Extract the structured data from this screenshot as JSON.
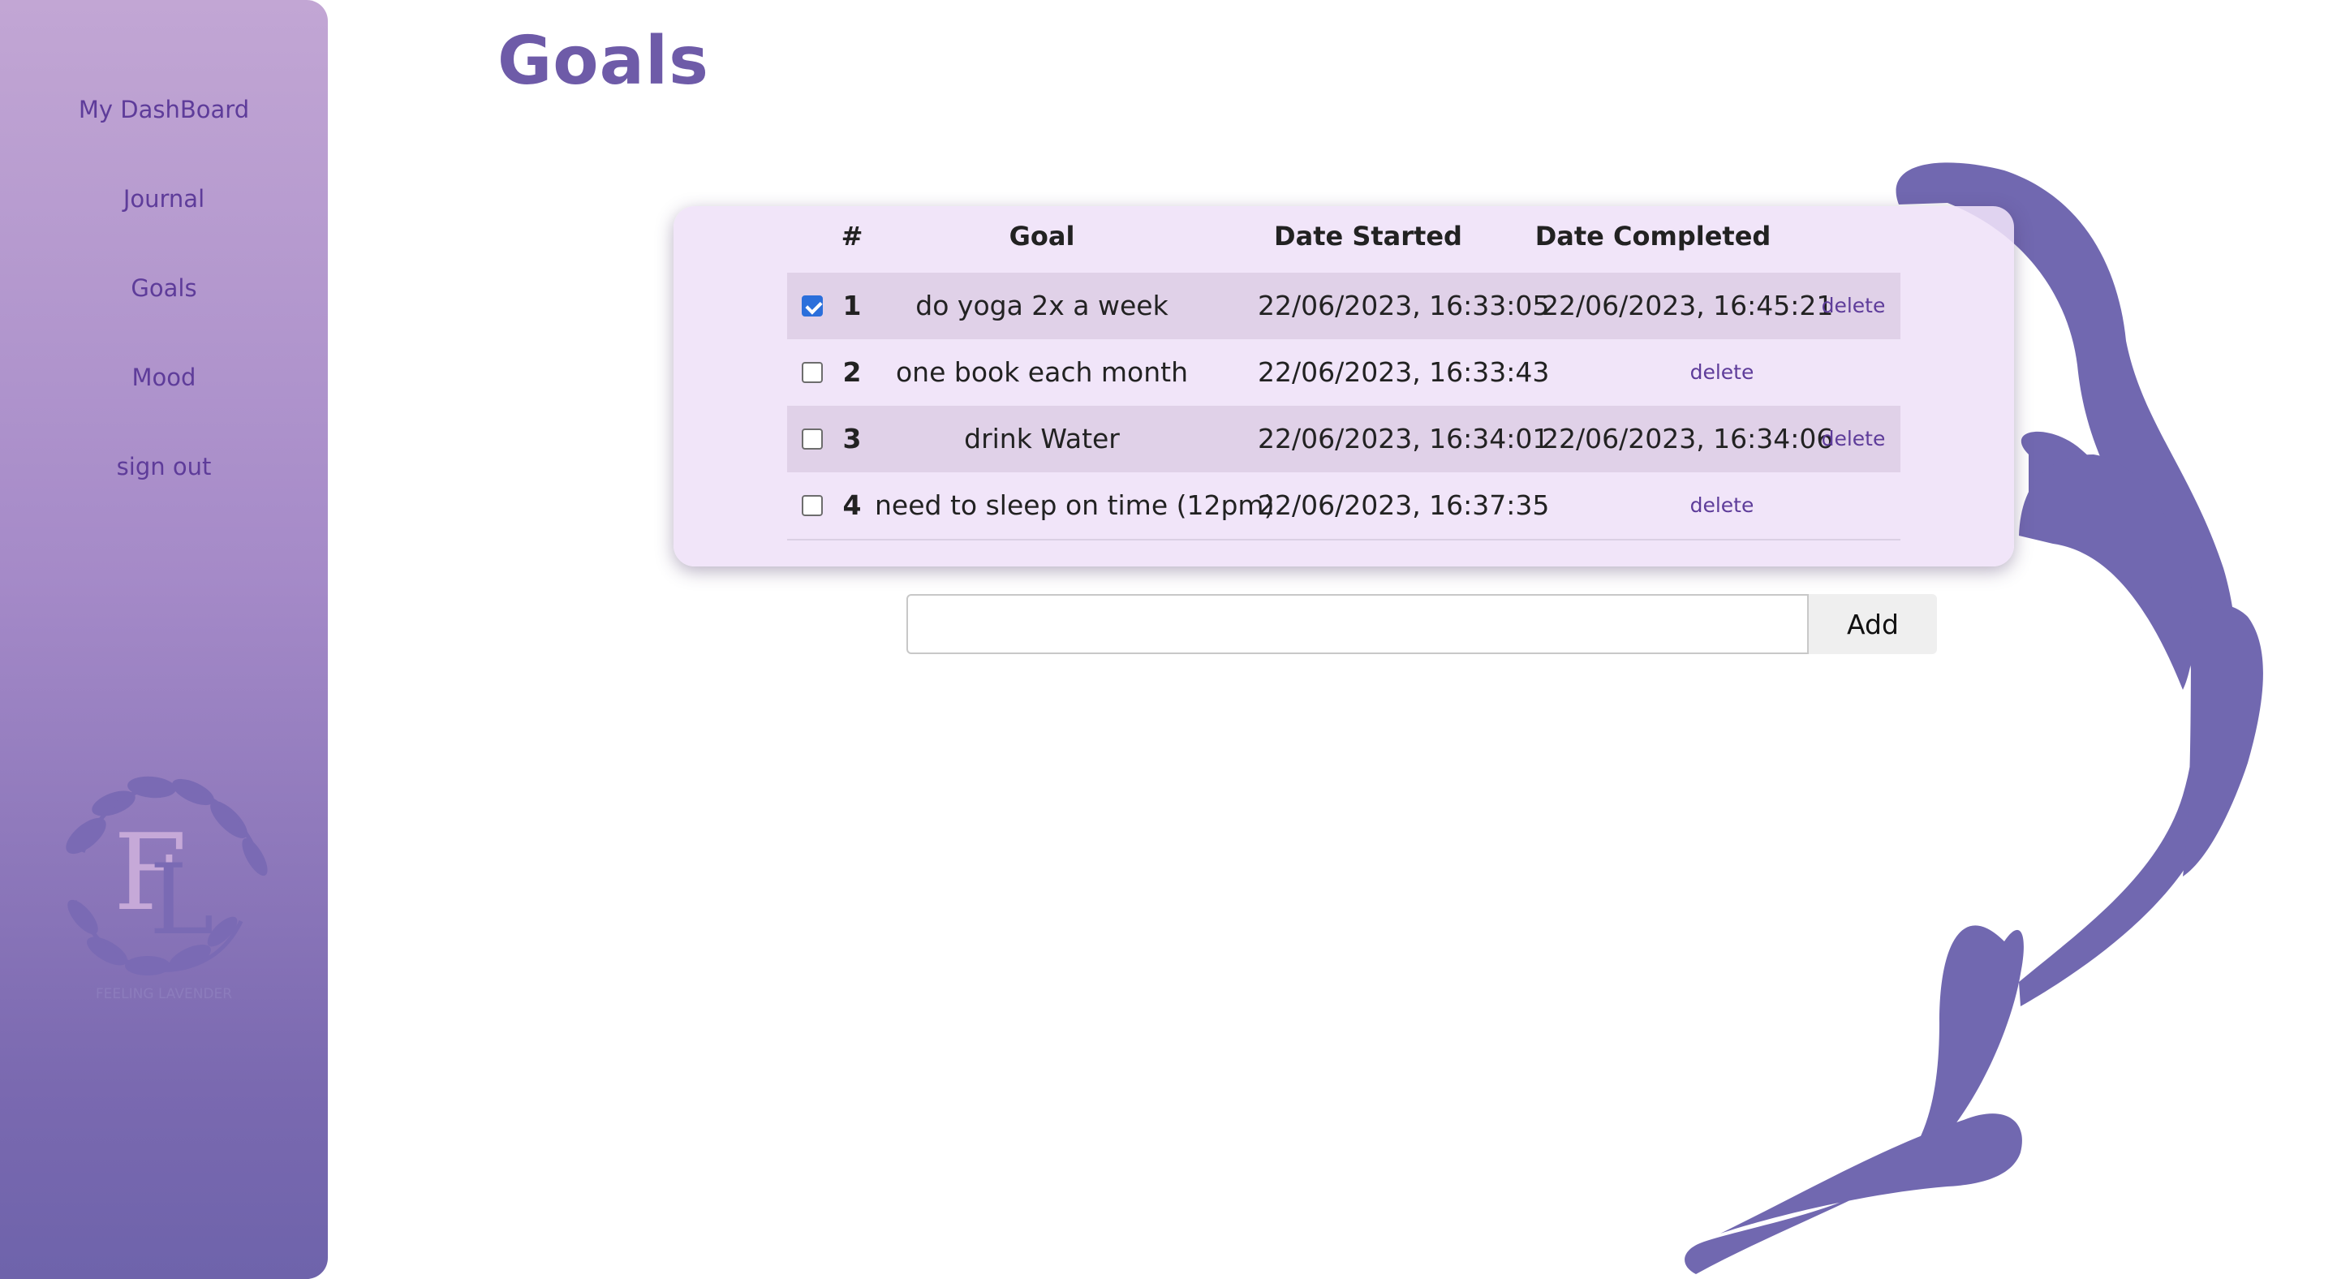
{
  "page": {
    "title": "Goals"
  },
  "sidebar": {
    "items": [
      {
        "label": "My DashBoard"
      },
      {
        "label": "Journal"
      },
      {
        "label": "Goals"
      },
      {
        "label": "Mood"
      },
      {
        "label": "sign out"
      }
    ],
    "logo": {
      "letters": "FL",
      "caption": "FEELING LAVENDER"
    }
  },
  "goals_table": {
    "headers": {
      "number": "#",
      "goal": "Goal",
      "date_started": "Date Started",
      "date_completed": "Date Completed"
    },
    "rows": [
      {
        "checked": true,
        "number": "1",
        "goal": "do yoga 2x a week",
        "date_started": "22/06/2023, 16:33:05",
        "date_completed": "22/06/2023, 16:45:21",
        "delete_label": "delete"
      },
      {
        "checked": false,
        "number": "2",
        "goal": "one book each month",
        "date_started": "22/06/2023, 16:33:43",
        "date_completed": "",
        "delete_label": "delete"
      },
      {
        "checked": false,
        "number": "3",
        "goal": "drink Water",
        "date_started": "22/06/2023, 16:34:01",
        "date_completed": "22/06/2023, 16:34:06",
        "delete_label": "delete"
      },
      {
        "checked": false,
        "number": "4",
        "goal": "need to sleep on time (12pm)",
        "date_started": "22/06/2023, 16:37:35",
        "date_completed": "",
        "delete_label": "delete"
      }
    ]
  },
  "add_form": {
    "input_value": "",
    "button_label": "Add"
  },
  "colors": {
    "accent": "#6e5ba8",
    "nav_text": "#5e3c9a",
    "swirl": "#7168b0",
    "card": "#efe1f8"
  }
}
